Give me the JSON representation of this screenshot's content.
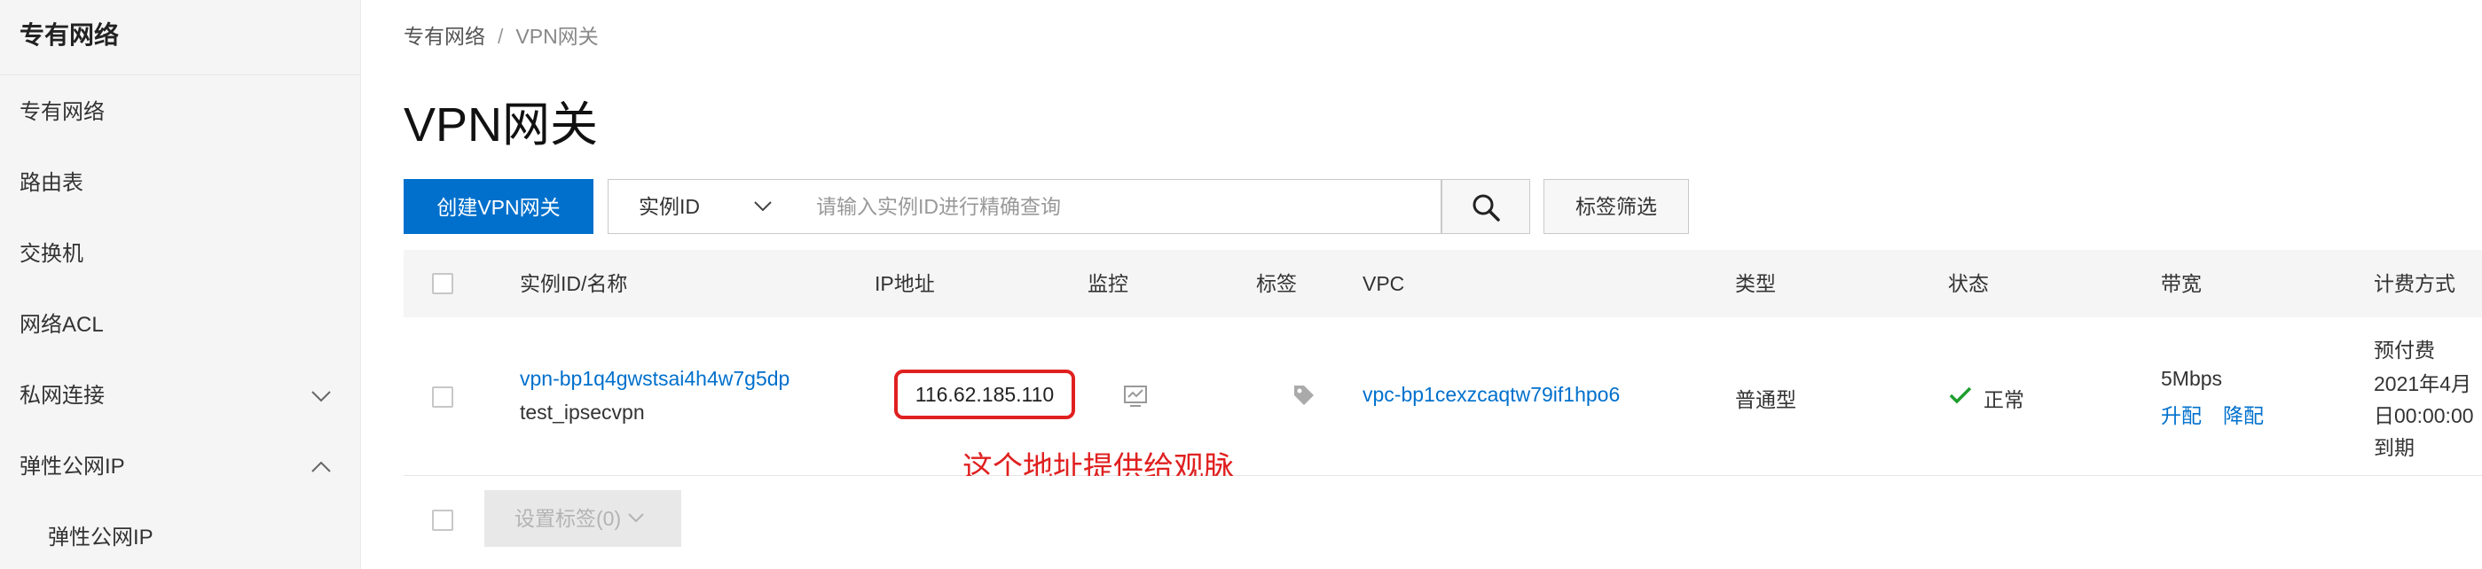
{
  "sidebar": {
    "title": "专有网络",
    "items": [
      {
        "label": "专有网络"
      },
      {
        "label": "路由表"
      },
      {
        "label": "交换机"
      },
      {
        "label": "网络ACL"
      },
      {
        "label": "私网连接"
      },
      {
        "label": "弹性公网IP"
      }
    ],
    "sub_items": [
      {
        "label": "弹性公网IP"
      }
    ]
  },
  "breadcrumb": {
    "root": "专有网络",
    "separator": "/",
    "current": "VPN网关"
  },
  "page_title": "VPN网关",
  "toolbar": {
    "create_label": "创建VPN网关",
    "filter_select": "实例ID",
    "search_placeholder": "请输入实例ID进行精确查询",
    "tag_filter_label": "标签筛选"
  },
  "table": {
    "columns": [
      "实例ID/名称",
      "IP地址",
      "监控",
      "标签",
      "VPC",
      "类型",
      "状态",
      "带宽",
      "计费方式"
    ],
    "rows": [
      {
        "instance_id": "vpn-bp1q4gwstsai4h4w7g5dp",
        "name": "test_ipsecvpn",
        "ip": "116.62.185.110",
        "vpc": "vpc-bp1cexzcaqtw79if1hpo6",
        "type": "普通型",
        "status": "正常",
        "bandwidth": "5Mbps",
        "upgrade_label": "升配",
        "downgrade_label": "降配",
        "billing_lines": [
          "预付费",
          "2021年4月",
          "日00:00:00",
          "到期"
        ]
      }
    ],
    "set_tags_label": "设置标签(0)"
  },
  "annotation": "这个地址提供给观脉",
  "colors": {
    "primary": "#0070cc",
    "annotation": "#e02020",
    "success": "#1e9e2e"
  }
}
